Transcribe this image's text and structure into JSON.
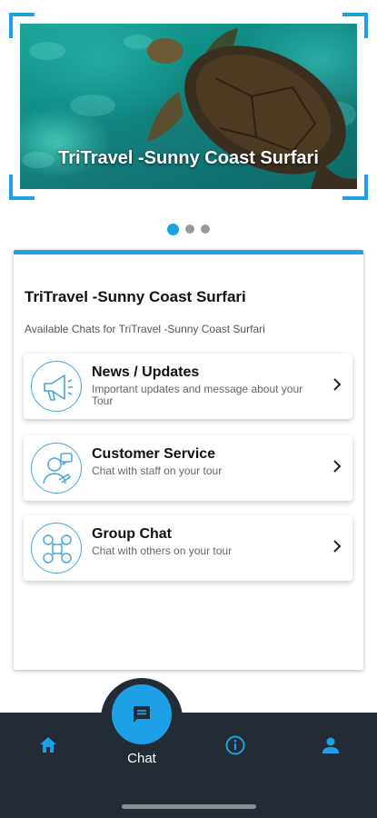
{
  "banner": {
    "title": "TriTravel -Sunny Coast Surfari",
    "image": "sea-turtle-photo"
  },
  "pager": {
    "count": 3,
    "active_index": 0
  },
  "card": {
    "title": "TriTravel -Sunny Coast Surfari",
    "subtitle": "Available Chats for TriTravel -Sunny Coast Surfari",
    "chats": [
      {
        "name": "News / Updates",
        "description": "Important updates and message about your Tour",
        "icon": "megaphone-icon"
      },
      {
        "name": "Customer Service",
        "description": "Chat with staff on your tour",
        "icon": "support-agent-icon"
      },
      {
        "name": "Group Chat",
        "description": "Chat with others on your tour",
        "icon": "group-icon"
      }
    ]
  },
  "nav": {
    "chat_label": "Chat",
    "items": [
      "home-icon",
      "chat-icon",
      "info-icon",
      "person-icon"
    ]
  },
  "colors": {
    "accent": "#1ea0e6",
    "nav_bg": "#232b35"
  }
}
